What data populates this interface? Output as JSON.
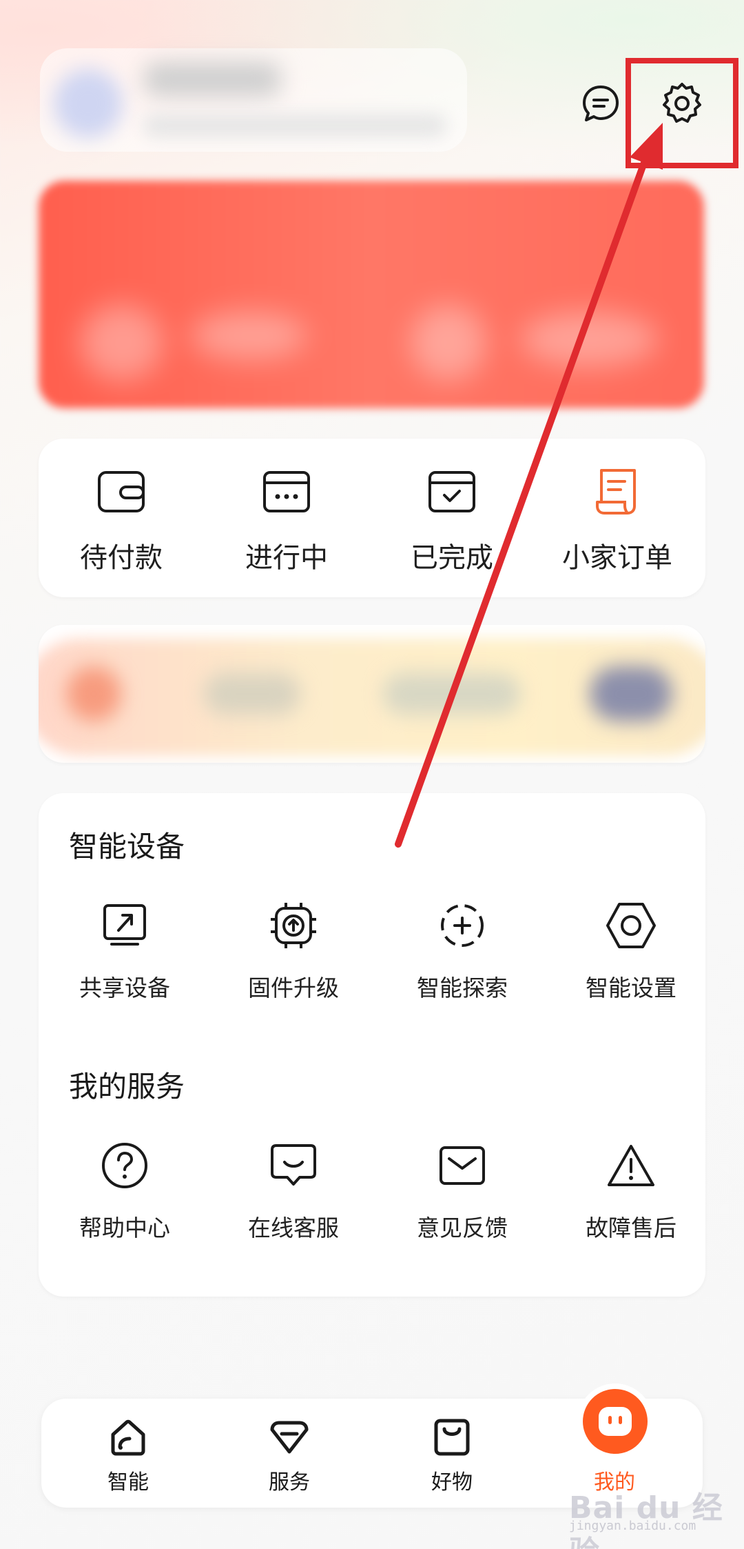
{
  "orders": [
    {
      "label": "待付款",
      "icon": "wallet-icon"
    },
    {
      "label": "进行中",
      "icon": "calendar-dots-icon"
    },
    {
      "label": "已完成",
      "icon": "calendar-check-icon"
    },
    {
      "label": "小家订单",
      "icon": "receipt-icon"
    }
  ],
  "smart_devices": {
    "title": "智能设备",
    "items": [
      {
        "label": "共享设备",
        "icon": "share-device-icon"
      },
      {
        "label": "固件升级",
        "icon": "firmware-upgrade-icon"
      },
      {
        "label": "智能探索",
        "icon": "smart-explore-icon"
      },
      {
        "label": "智能设置",
        "icon": "hexagon-settings-icon"
      }
    ]
  },
  "my_services": {
    "title": "我的服务",
    "items": [
      {
        "label": "帮助中心",
        "icon": "question-circle-icon"
      },
      {
        "label": "在线客服",
        "icon": "chat-service-icon"
      },
      {
        "label": "意见反馈",
        "icon": "feedback-mail-icon"
      },
      {
        "label": "故障售后",
        "icon": "warning-triangle-icon"
      }
    ]
  },
  "tabbar": {
    "items": [
      {
        "label": "智能",
        "icon": "smart-home-icon"
      },
      {
        "label": "服务",
        "icon": "diamond-service-icon"
      },
      {
        "label": "好物",
        "icon": "shopping-bag-icon"
      },
      {
        "label": "我的",
        "icon": "robot-face-icon",
        "active": true
      }
    ]
  },
  "watermark": {
    "text": "Bai du 经验",
    "sub": "jingyan.baidu.com"
  },
  "colors": {
    "accent": "#ff5a1f",
    "highlight": "#e02b2f",
    "order_accent": "#f26a35"
  }
}
